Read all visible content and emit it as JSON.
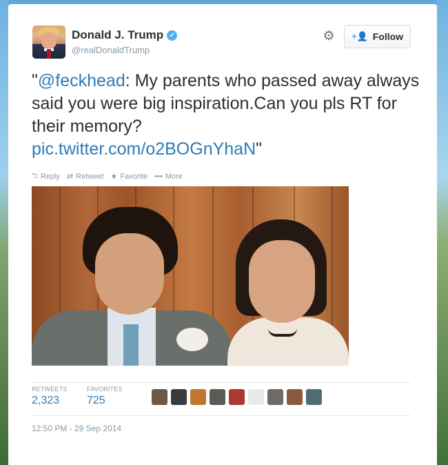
{
  "author": {
    "display_name": "Donald J. Trump",
    "handle": "@realDonaldTrump",
    "verified": true
  },
  "header": {
    "follow_label": "Follow",
    "follow_icon": "add-user-icon",
    "settings_icon": "gear-icon"
  },
  "tweet": {
    "open_quote": "\"",
    "mention": "@feckhead",
    "body": ":  My parents who passed away always said you were big inspiration.Can you pls RT for their memory?",
    "link": "pic.twitter.com/o2BOGnYhaN",
    "close_quote": "\""
  },
  "actions": [
    {
      "label": "Reply",
      "icon": "reply-icon"
    },
    {
      "label": "Retweet",
      "icon": "retweet-icon"
    },
    {
      "label": "Favorite",
      "icon": "star-icon"
    },
    {
      "label": "More",
      "icon": "more-icon"
    }
  ],
  "stats": {
    "retweets_label": "RETWEETS",
    "retweets_value": "2,323",
    "favorites_label": "FAVORITES",
    "favorites_value": "725"
  },
  "favorited_by_colors": [
    "#6b5a46",
    "#3b3a3c",
    "#c0762f",
    "#5d5a55",
    "#a83b2e",
    "#e9e9e9",
    "#6e6a68",
    "#8a5a3a",
    "#4f6b76"
  ],
  "timestamp": "12:50 PM - 29 Sep 2014",
  "colors": {
    "link": "#2b7bb9",
    "muted": "#8899a6",
    "text": "#292f33",
    "verified": "#55acee"
  }
}
